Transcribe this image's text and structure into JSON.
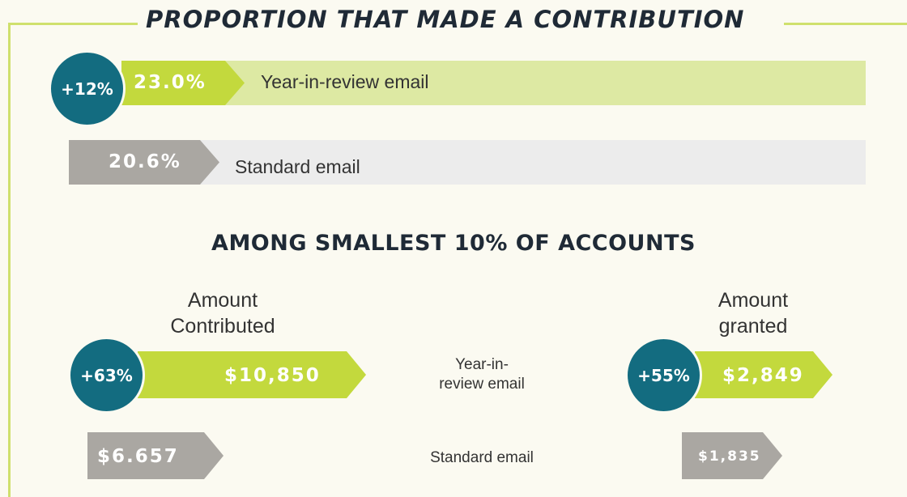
{
  "colors": {
    "background": "#fbfaf1",
    "accent_green": "#c3d93d",
    "light_green": "#dde9a3",
    "gray": "#aaa7a2",
    "light_gray": "#ececec",
    "teal": "#136c80",
    "frame": "#cfe06d"
  },
  "title": "PROPORTION THAT MADE A CONTRIBUTION",
  "proportion": {
    "review": {
      "value": "23.0%",
      "label": "Year-in-review email",
      "badge": "+12%"
    },
    "standard": {
      "value": "20.6%",
      "label": "Standard email"
    }
  },
  "subtitle": "AMONG SMALLEST 10% OF ACCOUNTS",
  "amounts": {
    "contributed_header": [
      "Amount",
      "Contributed"
    ],
    "granted_header": [
      "Amount",
      "granted"
    ],
    "review_label": [
      "Year-in-",
      "review email"
    ],
    "standard_label": "Standard email",
    "contributed": {
      "review": "$10,850",
      "standard": "$6.657",
      "badge": "+63%"
    },
    "granted": {
      "review": "$2,849",
      "standard": "$1,835",
      "badge": "+55%"
    }
  },
  "chart_data": [
    {
      "type": "bar",
      "title": "PROPORTION THAT MADE A CONTRIBUTION",
      "categories": [
        "Year-in-review email",
        "Standard email"
      ],
      "values": [
        23.0,
        20.6
      ],
      "annotations": [
        "+12%"
      ]
    },
    {
      "type": "bar",
      "title": "AMONG SMALLEST 10% OF ACCOUNTS",
      "categories": [
        "Year-in-review email",
        "Standard email"
      ],
      "series": [
        {
          "name": "Amount Contributed",
          "values": [
            10850,
            6657
          ]
        },
        {
          "name": "Amount granted",
          "values": [
            2849,
            1835
          ]
        }
      ],
      "annotations": [
        "+63%",
        "+55%"
      ]
    }
  ]
}
